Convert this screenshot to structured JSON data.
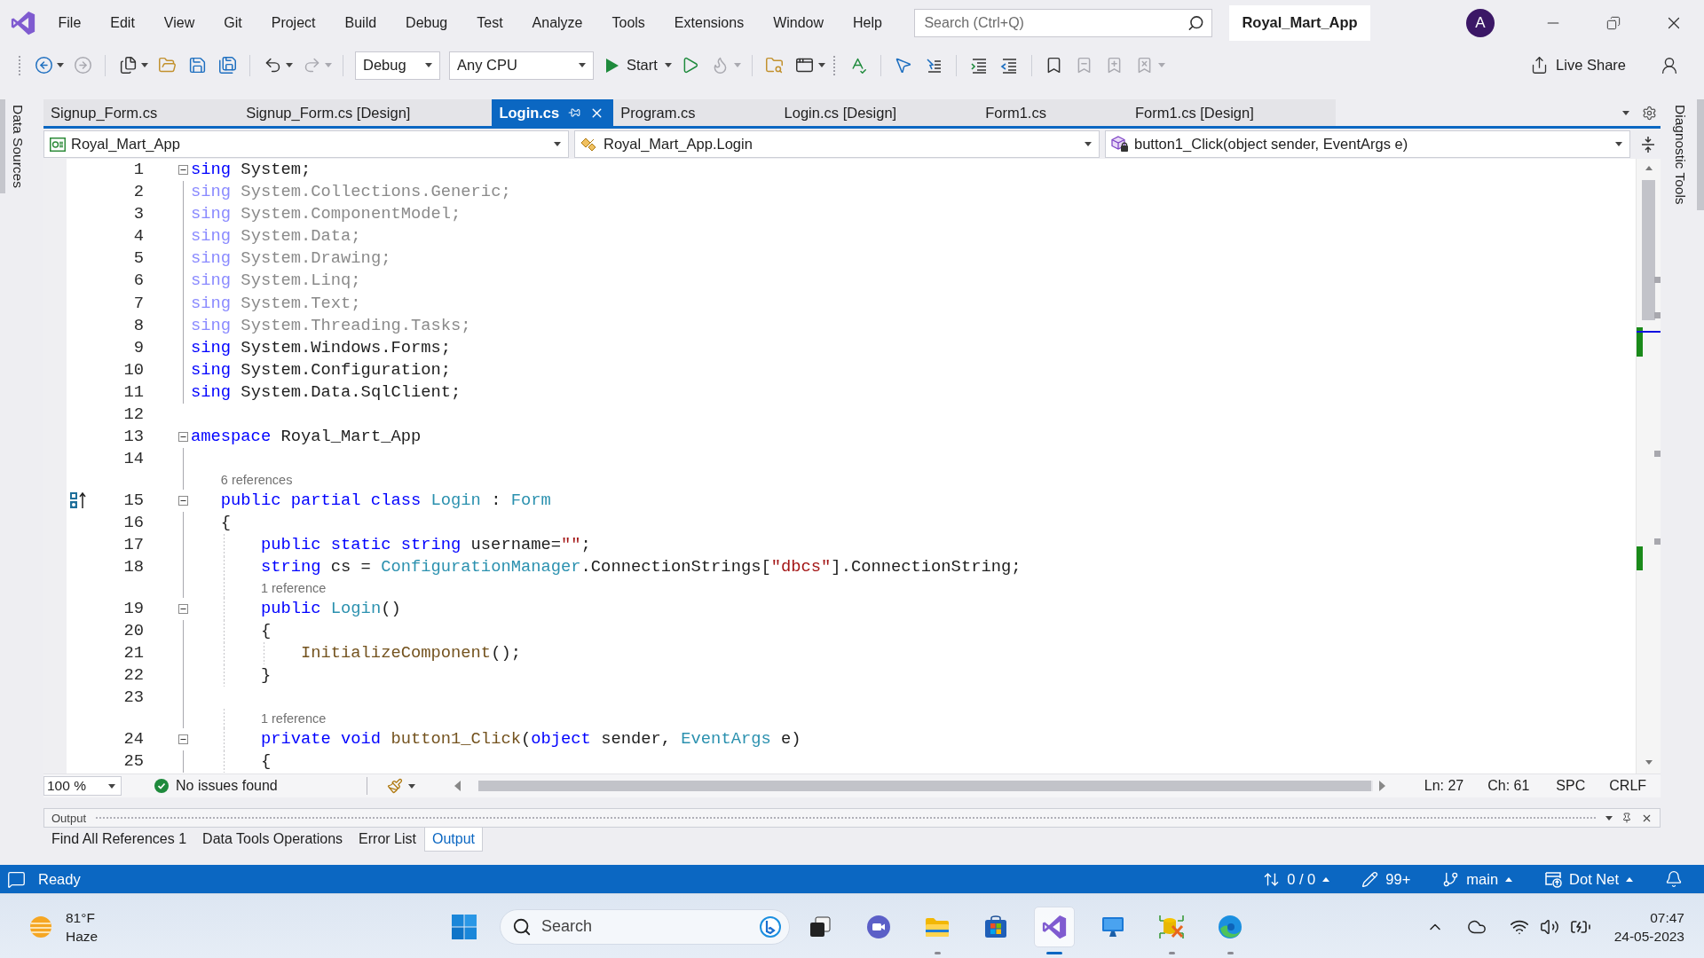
{
  "title_bar": {
    "menu": [
      "File",
      "Edit",
      "View",
      "Git",
      "Project",
      "Build",
      "Debug",
      "Test",
      "Analyze",
      "Tools",
      "Extensions",
      "Window",
      "Help"
    ],
    "search": {
      "placeholder": "Search (Ctrl+Q)"
    },
    "solution": "Royal_Mart_App",
    "avatar": "A"
  },
  "toolbar": {
    "items": [
      {
        "kind": "grip"
      },
      {
        "kind": "back",
        "disabled": false,
        "menu": true
      },
      {
        "kind": "forward",
        "disabled": true,
        "menu": false
      },
      {
        "kind": "separator"
      },
      {
        "kind": "new",
        "disabled": false,
        "menu": true
      },
      {
        "kind": "open",
        "disabled": false,
        "menu": false
      },
      {
        "kind": "save",
        "disabled": false,
        "menu": false
      },
      {
        "kind": "saveall",
        "disabled": false,
        "menu": false
      },
      {
        "kind": "separator"
      },
      {
        "kind": "undo",
        "disabled": false,
        "menu": true
      },
      {
        "kind": "redo",
        "disabled": true,
        "menu": true
      },
      {
        "kind": "separator"
      },
      {
        "kind": "dropdown",
        "value": "Debug"
      },
      {
        "kind": "dropdown",
        "value": "Any CPU"
      },
      {
        "kind": "start",
        "label": "Start",
        "menu": true
      },
      {
        "kind": "run",
        "disabled": false,
        "menu": false
      },
      {
        "kind": "reload",
        "disabled": true,
        "menu": true
      },
      {
        "kind": "separator"
      },
      {
        "kind": "find",
        "disabled": false,
        "menu": false
      },
      {
        "kind": "layout",
        "disabled": false,
        "menu": true
      },
      {
        "kind": "grip"
      },
      {
        "kind": "spelling",
        "disabled": false,
        "menu": false
      },
      {
        "kind": "separator"
      },
      {
        "kind": "select",
        "disabled": false,
        "menu": false
      },
      {
        "kind": "step",
        "disabled": false,
        "menu": false
      },
      {
        "kind": "separator"
      },
      {
        "kind": "indent",
        "disabled": false,
        "menu": false
      },
      {
        "kind": "outdent",
        "disabled": false,
        "menu": false
      },
      {
        "kind": "separator"
      },
      {
        "kind": "bookmark",
        "disabled": false,
        "menu": false
      },
      {
        "kind": "previous",
        "disabled": true,
        "menu": false
      },
      {
        "kind": "next",
        "disabled": true,
        "menu": false
      },
      {
        "kind": "clear",
        "disabled": true,
        "menu": true
      }
    ],
    "live_share": "Live Share"
  },
  "side_tabs": {
    "left": "Data Sources",
    "right": "Diagnostic Tools"
  },
  "document_tabs": [
    {
      "label": "Signup_Form.cs",
      "selected": false
    },
    {
      "label": "Signup_Form.cs [Design]",
      "selected": false
    },
    {
      "label": "Login.cs",
      "selected": true
    },
    {
      "label": "Program.cs",
      "selected": false
    },
    {
      "label": "Login.cs [Design]",
      "selected": false
    },
    {
      "label": "Form1.cs",
      "selected": false
    },
    {
      "label": "Form1.cs [Design]",
      "selected": false
    }
  ],
  "editor": {
    "navigation": {
      "project": "Royal_Mart_App",
      "type": "Royal_Mart_App.Login",
      "member": "button1_Click(object sender, EventArgs e)"
    },
    "lines": [
      {
        "kind": "code",
        "number": "1",
        "fold": true,
        "marker": false,
        "tokens": [
          {
            "kind": "keyword",
            "text": "sing"
          },
          {
            "kind": "plain",
            "text": " System;"
          }
        ]
      },
      {
        "kind": "code",
        "number": "2",
        "fold": false,
        "marker": false,
        "tokens": [
          {
            "kind": "muted",
            "text": "sing"
          },
          {
            "kind": "gray",
            "text": " System.Collections.Generic;"
          }
        ]
      },
      {
        "kind": "code",
        "number": "3",
        "fold": false,
        "marker": false,
        "tokens": [
          {
            "kind": "muted",
            "text": "sing"
          },
          {
            "kind": "gray",
            "text": " System.ComponentModel;"
          }
        ]
      },
      {
        "kind": "code",
        "number": "4",
        "fold": false,
        "marker": false,
        "tokens": [
          {
            "kind": "muted",
            "text": "sing"
          },
          {
            "kind": "gray",
            "text": " System.Data;"
          }
        ]
      },
      {
        "kind": "code",
        "number": "5",
        "fold": false,
        "marker": false,
        "tokens": [
          {
            "kind": "muted",
            "text": "sing"
          },
          {
            "kind": "gray",
            "text": " System.Drawing;"
          }
        ]
      },
      {
        "kind": "code",
        "number": "6",
        "fold": false,
        "marker": false,
        "tokens": [
          {
            "kind": "muted",
            "text": "sing"
          },
          {
            "kind": "gray",
            "text": " System.Linq;"
          }
        ]
      },
      {
        "kind": "code",
        "number": "7",
        "fold": false,
        "marker": false,
        "tokens": [
          {
            "kind": "muted",
            "text": "sing"
          },
          {
            "kind": "gray",
            "text": " System.Text;"
          }
        ]
      },
      {
        "kind": "code",
        "number": "8",
        "fold": false,
        "marker": false,
        "tokens": [
          {
            "kind": "muted",
            "text": "sing"
          },
          {
            "kind": "gray",
            "text": " System.Threading.Tasks;"
          }
        ]
      },
      {
        "kind": "code",
        "number": "9",
        "fold": false,
        "marker": false,
        "tokens": [
          {
            "kind": "keyword",
            "text": "sing"
          },
          {
            "kind": "plain",
            "text": " System.Windows.Forms;"
          }
        ]
      },
      {
        "kind": "code",
        "number": "10",
        "fold": false,
        "marker": false,
        "tokens": [
          {
            "kind": "keyword",
            "text": "sing"
          },
          {
            "kind": "plain",
            "text": " System.Configuration;"
          }
        ]
      },
      {
        "kind": "code",
        "number": "11",
        "fold": false,
        "marker": false,
        "tokens": [
          {
            "kind": "keyword",
            "text": "sing"
          },
          {
            "kind": "plain",
            "text": " System.Data.SqlClient;"
          }
        ]
      },
      {
        "kind": "code",
        "number": "12",
        "fold": false,
        "marker": false
      },
      {
        "kind": "code",
        "number": "13",
        "fold": true,
        "marker": false,
        "tokens": [
          {
            "kind": "keyword",
            "text": "amespace"
          },
          {
            "kind": "plain",
            "text": " Royal_Mart_App"
          }
        ]
      },
      {
        "kind": "code",
        "number": "14",
        "fold": false,
        "marker": false
      },
      {
        "kind": "lens",
        "text": "6 references"
      },
      {
        "kind": "code",
        "number": "15",
        "fold": true,
        "marker": true,
        "tokens": [
          {
            "kind": "keyword",
            "text": "   public partial class "
          },
          {
            "kind": "type",
            "text": "Login"
          },
          {
            "kind": "plain",
            "text": " : "
          },
          {
            "kind": "type",
            "text": "Form"
          }
        ]
      },
      {
        "kind": "code",
        "number": "16",
        "fold": false,
        "marker": false,
        "tokens": [
          {
            "kind": "plain",
            "text": "   {"
          }
        ]
      },
      {
        "kind": "code",
        "number": "17",
        "fold": false,
        "marker": false,
        "tokens": [
          {
            "kind": "keyword",
            "text": "       public static string"
          },
          {
            "kind": "plain",
            "text": " username="
          },
          {
            "kind": "string",
            "text": "\"\""
          },
          {
            "kind": "plain",
            "text": ";"
          }
        ]
      },
      {
        "kind": "code",
        "number": "18",
        "fold": false,
        "marker": false,
        "tokens": [
          {
            "kind": "keyword",
            "text": "       string"
          },
          {
            "kind": "plain",
            "text": " cs = "
          },
          {
            "kind": "type",
            "text": "ConfigurationManager"
          },
          {
            "kind": "plain",
            "text": ".ConnectionStrings["
          },
          {
            "kind": "string",
            "text": "\"dbcs\""
          },
          {
            "kind": "plain",
            "text": "].ConnectionString;"
          }
        ]
      },
      {
        "kind": "lens",
        "text": "1 reference"
      },
      {
        "kind": "code",
        "number": "19",
        "fold": true,
        "marker": false,
        "tokens": [
          {
            "kind": "keyword",
            "text": "       public "
          },
          {
            "kind": "type",
            "text": "Login"
          },
          {
            "kind": "plain",
            "text": "()"
          }
        ]
      },
      {
        "kind": "code",
        "number": "20",
        "fold": false,
        "marker": false,
        "tokens": [
          {
            "kind": "plain",
            "text": "       {"
          }
        ]
      },
      {
        "kind": "code",
        "number": "21",
        "fold": false,
        "marker": false,
        "tokens": [
          {
            "kind": "method",
            "text": "           InitializeComponent"
          },
          {
            "kind": "plain",
            "text": "();"
          }
        ]
      },
      {
        "kind": "code",
        "number": "22",
        "fold": false,
        "marker": false,
        "tokens": [
          {
            "kind": "plain",
            "text": "       }"
          }
        ]
      },
      {
        "kind": "code",
        "number": "23",
        "fold": false,
        "marker": false
      },
      {
        "kind": "lens",
        "text": "1 reference"
      },
      {
        "kind": "code",
        "number": "24",
        "fold": true,
        "marker": false,
        "tokens": [
          {
            "kind": "keyword",
            "text": "       private void "
          },
          {
            "kind": "method",
            "text": "button1_Click"
          },
          {
            "kind": "plain",
            "text": "("
          },
          {
            "kind": "keyword",
            "text": "object"
          },
          {
            "kind": "plain",
            "text": " sender, "
          },
          {
            "kind": "type",
            "text": "EventArgs"
          },
          {
            "kind": "plain",
            "text": " e)"
          }
        ]
      },
      {
        "kind": "code",
        "number": "25",
        "fold": false,
        "marker": false,
        "tokens": [
          {
            "kind": "plain",
            "text": "       {"
          }
        ]
      }
    ],
    "status": {
      "zoom": "100 %",
      "issues": "No issues found",
      "line": "Ln: 27",
      "column": "Ch: 61",
      "whitespace": "SPC",
      "line_ending": "CRLF"
    }
  },
  "output_panel": {
    "title": "Output",
    "tabs": [
      {
        "label": "Find All References 1",
        "selected": false
      },
      {
        "label": "Data Tools Operations",
        "selected": false
      },
      {
        "label": "Error List",
        "selected": false
      },
      {
        "label": "Output",
        "selected": true
      }
    ]
  },
  "status_bar": {
    "message": "Ready",
    "items": [
      {
        "kind": "sync",
        "text": "0 / 0",
        "caret": true
      },
      {
        "kind": "edits",
        "text": "99+",
        "caret": false
      },
      {
        "kind": "branch",
        "text": "main",
        "caret": true
      },
      {
        "kind": "repository",
        "text": "Dot Net",
        "caret": true
      }
    ]
  },
  "taskbar": {
    "weather": {
      "temperature": "81°F",
      "condition": "Haze"
    },
    "search": {
      "placeholder": "Search"
    },
    "apps": [
      {
        "kind": "taskview",
        "running": false,
        "active": false
      },
      {
        "kind": "chat",
        "running": false,
        "active": false
      },
      {
        "kind": "explorer",
        "running": true,
        "active": false
      },
      {
        "kind": "store",
        "running": false,
        "active": false
      },
      {
        "kind": "studio",
        "running": true,
        "active": true
      },
      {
        "kind": "remote",
        "running": false,
        "active": false
      },
      {
        "kind": "tool",
        "running": true,
        "active": false
      },
      {
        "kind": "edge",
        "running": true,
        "active": false
      }
    ],
    "clock": {
      "time": "07:47",
      "date": "24-05-2023"
    }
  }
}
